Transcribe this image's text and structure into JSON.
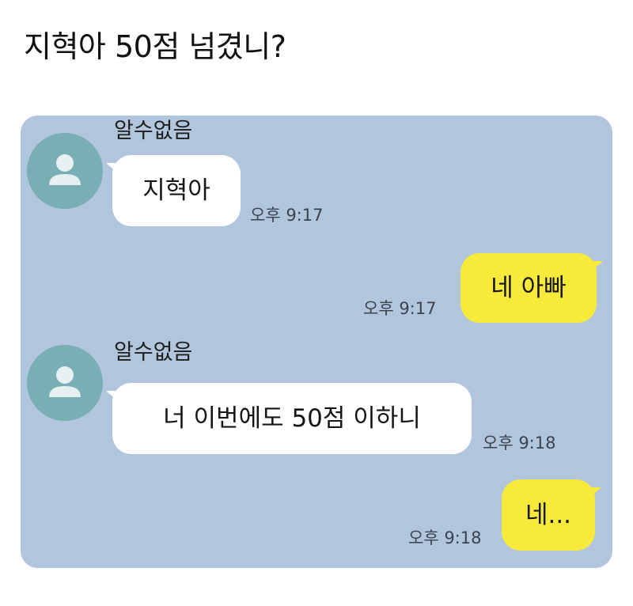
{
  "post": {
    "title": "지혁아 50점 넘겼니?"
  },
  "chat": {
    "background_color": "#b1c6dd",
    "incoming_bubble_color": "#ffffff",
    "outgoing_bubble_color": "#f8ea3b",
    "avatar_icon": "default-person-icon",
    "messages": [
      {
        "sender": "알수없음",
        "text": "지혁아",
        "time": "오후 9:17",
        "direction": "incoming"
      },
      {
        "text": "네 아빠",
        "time": "오후 9:17",
        "direction": "outgoing"
      },
      {
        "sender": "알수없음",
        "text": "너 이번에도 50점 이하니",
        "time": "오후 9:18",
        "direction": "incoming"
      },
      {
        "text": "네...",
        "time": "오후 9:18",
        "direction": "outgoing"
      }
    ]
  }
}
